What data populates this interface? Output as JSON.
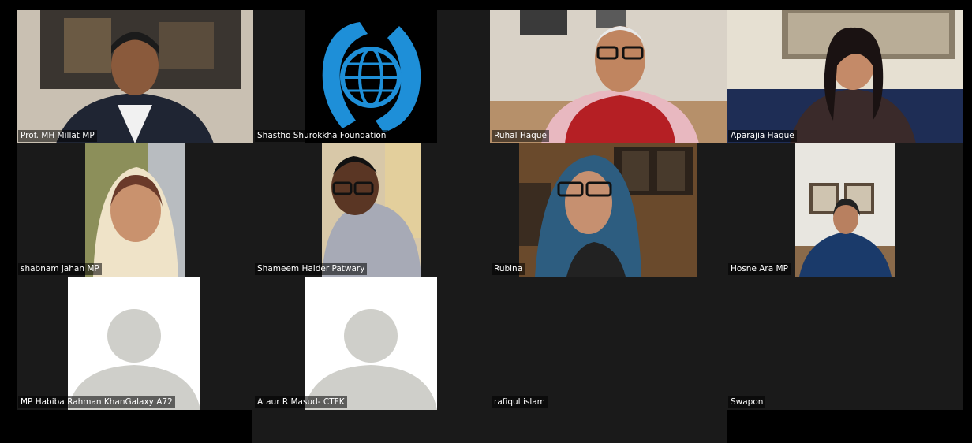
{
  "participants": [
    {
      "name": "Prof. MH Millat MP"
    },
    {
      "name": "Shastho Shurokkha Foundation"
    },
    {
      "name": "Ruhal Haque"
    },
    {
      "name": "Aparajia Haque"
    },
    {
      "name": "shabnam jahan MP"
    },
    {
      "name": "Shameem Haider Patwary"
    },
    {
      "name": "Rubina"
    },
    {
      "name": "Hosne Ara MP"
    },
    {
      "name": "MP Habiba Rahman KhanGalaxy A72"
    },
    {
      "name": "Ataur R Masud- CTFK"
    },
    {
      "name": "rafiqul islam"
    },
    {
      "name": "Swapon"
    }
  ],
  "colors": {
    "tile_bg": "#1a1a1a",
    "logo_blue": "#1e8fd8",
    "avatar_gray": "#cfcfca"
  },
  "icons": [
    "globe-hands-logo-icon",
    "person-avatar-icon"
  ]
}
